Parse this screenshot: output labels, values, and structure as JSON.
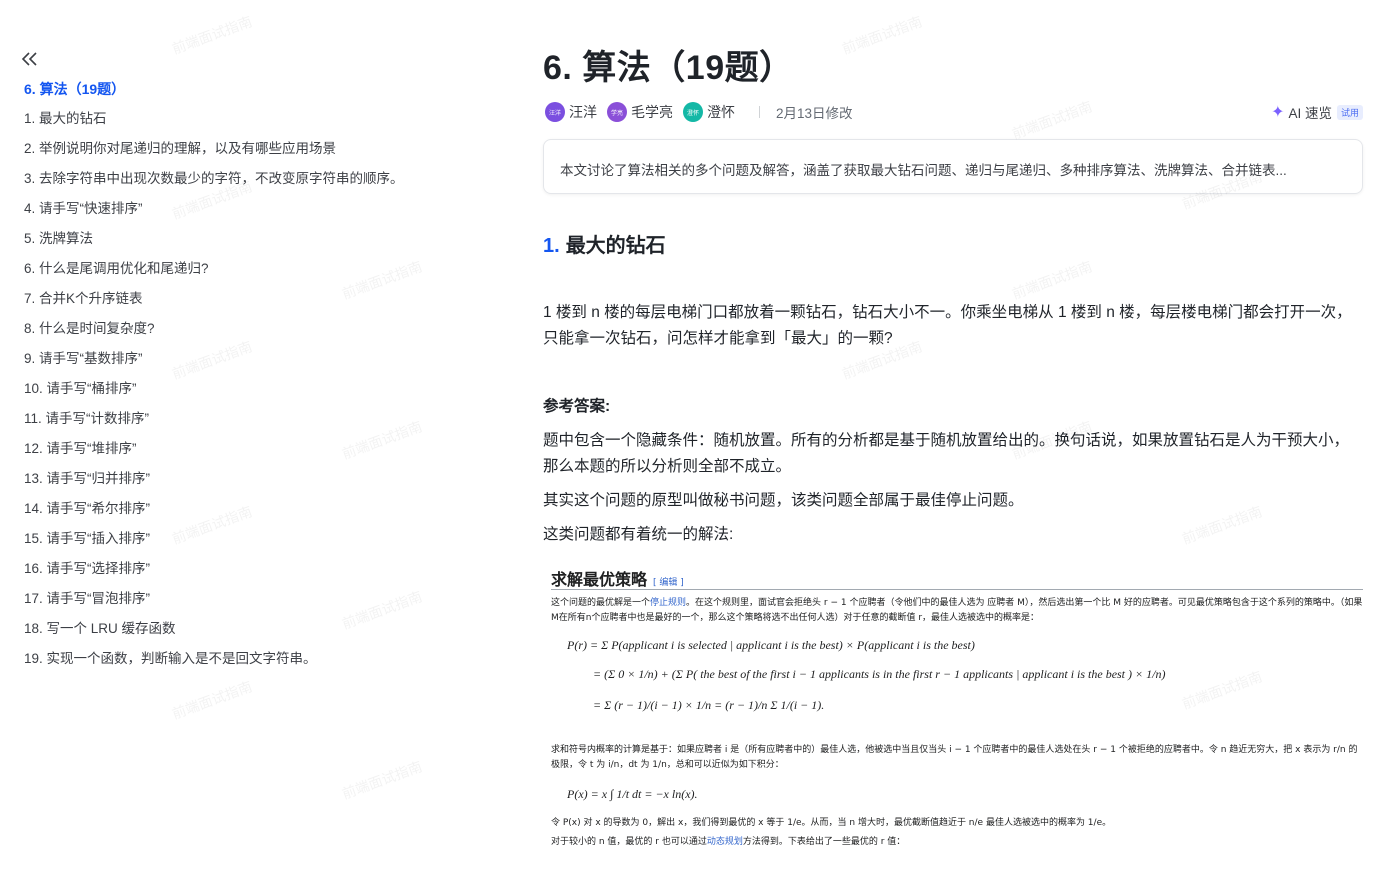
{
  "sidebar": {
    "collapse_label": "«",
    "toc": [
      "6. 算法（19题）",
      "1. 最大的钻石",
      "2. 举例说明你对尾递归的理解，以及有哪些应用场景",
      "3. 去除字符串中出现次数最少的字符，不改变原字符串的顺序。",
      "4. 请手写“快速排序”",
      "5. 洗牌算法",
      "6. 什么是尾调用优化和尾递归?",
      "7. 合并K个升序链表",
      "8. 什么是时间复杂度?",
      "9. 请手写“基数排序”",
      "10. 请手写“桶排序”",
      "11. 请手写“计数排序”",
      "12. 请手写“堆排序”",
      "13. 请手写“归并排序”",
      "14. 请手写“希尔排序”",
      "15. 请手写“插入排序”",
      "16. 请手写“选择排序”",
      "17. 请手写“冒泡排序”",
      "18. 写一个 LRU 缓存函数",
      "19. 实现一个函数，判断输入是不是回文字符串。"
    ]
  },
  "doc": {
    "title": "6. 算法（19题）",
    "authors": [
      {
        "name": "汪洋",
        "avatar_text": "汪洋",
        "color": "#7b4fe0"
      },
      {
        "name": "毛学亮",
        "avatar_text": "学亮",
        "color": "#8a4fd8"
      },
      {
        "name": "澄怀",
        "avatar_text": "澄怀",
        "color": "#14b8a6"
      }
    ],
    "modified": "2月13日修改",
    "ai_label": "AI 速览",
    "ai_badge": "试用",
    "summary": "本文讨论了算法相关的多个问题及解答，涵盖了获取最大钻石问题、递归与尾递归、多种排序算法、洗牌算法、合并链表...",
    "section_num": "1.",
    "section_title": "最大的钻石",
    "question": "1 楼到 n 楼的每层电梯门口都放着一颗钻石，钻石大小不一。你乘坐电梯从 1 楼到 n 楼，每层楼电梯门都会打开一次，只能拿一次钻石，问怎样才能拿到「最大」的一颗?",
    "ref_label": "参考答案:",
    "answer_1": "题中包含一个隐藏条件：随机放置。所有的分析都是基于随机放置给出的。换句话说，如果放置钻石是人为干预大小，那么本题的所以分析则全部不成立。",
    "answer_2": "其实这个问题的原型叫做秘书问题，该类问题全部属于最佳停止问题。",
    "answer_3": "这类问题都有着统一的解法:"
  },
  "wiki": {
    "heading": "求解最优策略",
    "edit": "[ 编辑 ]",
    "p1_a": "这个问题的最优解是一个",
    "p1_link": "停止规则",
    "p1_b": "。在这个规则里，面试官会拒绝头 r − 1 个应聘者（令他们中的最佳人选为 应聘者 M），然后选出第一个比 M 好的应聘者。可见最优策略包含于这个系列的策略中。（如果M在所有n个应聘者中也是最好的一个，那么这个策略将选不出任何人选）对于任意的截断值 r，最佳人选被选中的概率是：",
    "f1": "P(r) = Σ P(applicant i is selected | applicant i is the best) × P(applicant i is the best)",
    "f2": "= (Σ 0 × 1/n) + (Σ P( the best of the first i − 1 applicants is in the first r − 1 applicants | applicant i is the best ) × 1/n)",
    "f3": "= Σ (r − 1)/(i − 1) × 1/n   =   (r − 1)/n Σ 1/(i − 1).",
    "p2": "求和符号内概率的计算是基于：如果应聘者 i 是（所有应聘者中的）最佳人选，他被选中当且仅当头 i − 1 个应聘者中的最佳人选处在头 r − 1 个被拒绝的应聘者中。令 n 趋近无穷大，把 x 表示为 r/n 的极限，令 t 为 i/n，dt 为 1/n，总和可以近似为如下积分：",
    "f4": "P(x) = x ∫ 1/t dt = −x ln(x).",
    "p3": "令 P(x) 对 x 的导数为 0，解出 x，我们得到最优的 x 等于 1/e。从而，当 n 增大时，最优截断值趋近于 n/e 最佳人选被选中的概率为 1/e。",
    "p4_a": "对于较小的 n 值，最优的 r 也可以通过",
    "p4_link": "动态规划",
    "p4_b": "方法得到。下表给出了一些最优的 r 值："
  },
  "watermark_text": "前端面试指南"
}
